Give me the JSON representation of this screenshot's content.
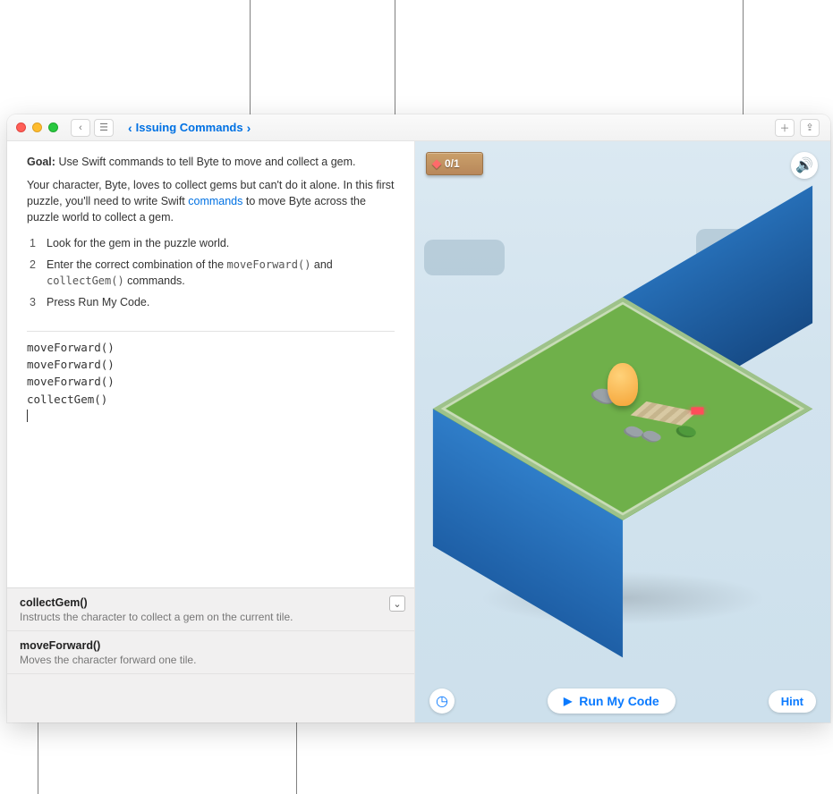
{
  "titlebar": {
    "breadcrumb_title": "Issuing Commands"
  },
  "instructions": {
    "goal_label": "Goal:",
    "goal_text": "Use Swift commands to tell Byte to move and collect a gem.",
    "para_before_link": "Your character, Byte, loves to collect gems but can't do it alone. In this first puzzle, you'll need to write Swift ",
    "link_text": "commands",
    "para_after_link": " to move Byte across the puzzle world to collect a gem.",
    "steps": [
      {
        "num": "1",
        "text": "Look for the gem in the puzzle world."
      },
      {
        "num": "2",
        "text_before": "Enter the correct combination of the ",
        "code1": "moveForward()",
        "mid": " and ",
        "code2": "collectGem()",
        "text_after": " commands."
      },
      {
        "num": "3",
        "text": "Press Run My Code."
      }
    ]
  },
  "code_lines": [
    "moveForward()",
    "moveForward()",
    "moveForward()",
    "collectGem()"
  ],
  "suggestions": [
    {
      "name": "collectGem()",
      "desc": "Instructs the character to collect a gem on the current tile."
    },
    {
      "name": "moveForward()",
      "desc": "Moves the character forward one tile."
    }
  ],
  "gem_counter": "0/1",
  "controls": {
    "run_label": "Run My Code",
    "hint_label": "Hint"
  },
  "icons": {
    "back": "‹",
    "fwd": "›",
    "sidebar": "☰",
    "add": "＋",
    "share": "⇪",
    "sound": "🔊",
    "speed": "◷",
    "play": "▶",
    "chev_down": "⌄",
    "gem": "◆",
    "chev_left": "‹",
    "chev_right": "›"
  }
}
